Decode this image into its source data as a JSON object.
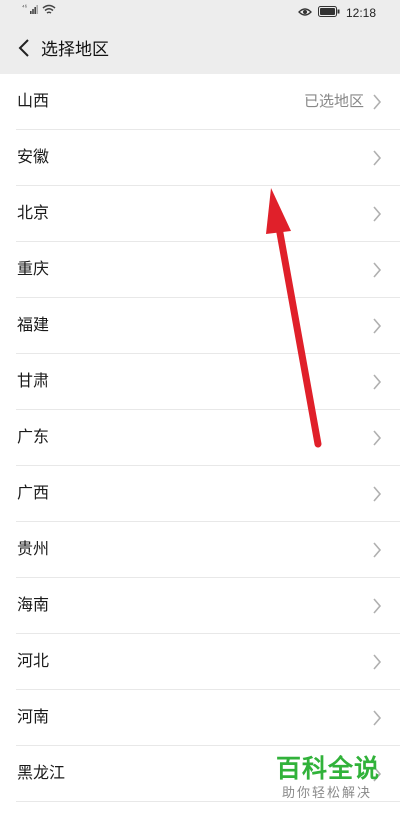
{
  "status_bar": {
    "network_label": "⁴⁶",
    "time": "12:18",
    "icons": [
      "signal-icon",
      "wifi-icon",
      "eye-icon",
      "battery-icon"
    ]
  },
  "nav": {
    "title": "选择地区",
    "back_icon": "chevron-left-icon"
  },
  "regions": [
    {
      "name": "山西",
      "extra": "已选地区"
    },
    {
      "name": "安徽",
      "extra": ""
    },
    {
      "name": "北京",
      "extra": ""
    },
    {
      "name": "重庆",
      "extra": ""
    },
    {
      "name": "福建",
      "extra": ""
    },
    {
      "name": "甘肃",
      "extra": ""
    },
    {
      "name": "广东",
      "extra": ""
    },
    {
      "name": "广西",
      "extra": ""
    },
    {
      "name": "贵州",
      "extra": ""
    },
    {
      "name": "海南",
      "extra": ""
    },
    {
      "name": "河北",
      "extra": ""
    },
    {
      "name": "河南",
      "extra": ""
    },
    {
      "name": "黑龙江",
      "extra": ""
    }
  ],
  "watermark": {
    "main": "百科全说",
    "sub": "助你轻松解决"
  },
  "colors": {
    "header_bg": "#ededed",
    "annotation_arrow": "#e0202a",
    "watermark_green": "#31b23a"
  }
}
